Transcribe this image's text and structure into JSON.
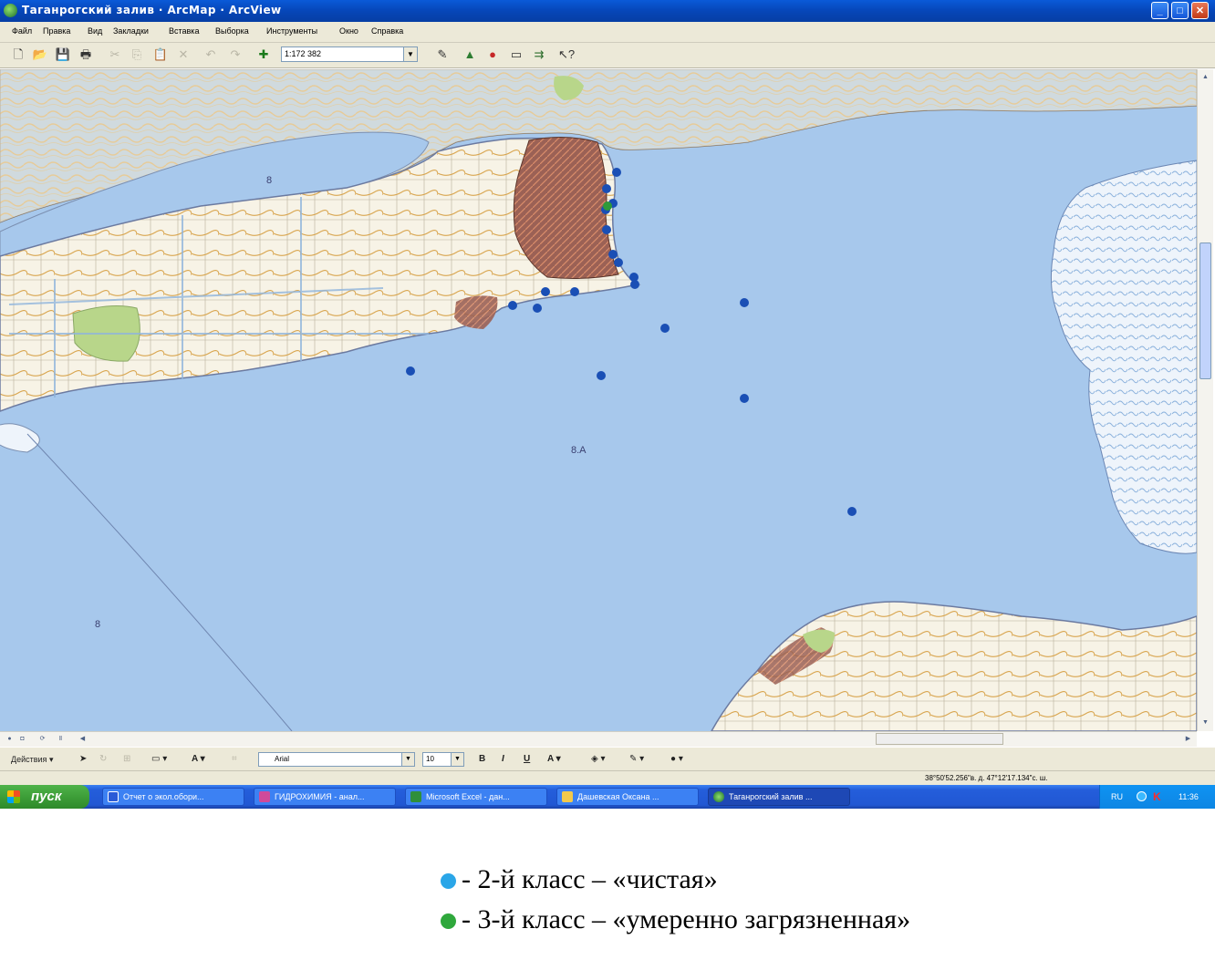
{
  "window": {
    "title": "Таганрогский залив · ArcMap · ArcView",
    "minimize_label": "_",
    "maximize_label": "□",
    "close_label": "✕"
  },
  "menu": {
    "items": [
      "Файл",
      "Правка",
      "Вид",
      "Закладки",
      "Вставка",
      "Выборка",
      "Инструменты",
      "Окно",
      "Справка"
    ]
  },
  "toolbar": {
    "scale": "1:172 382"
  },
  "map": {
    "labels": [
      "8",
      "8.A",
      "8"
    ],
    "water_color": "#a7c8ec",
    "land_color": "#f6f0e0",
    "contour_color": "#d9a650",
    "urban_color": "#9b6155",
    "station_class2_color": "#1a4fb5",
    "station_class3_color": "#2e9a3a"
  },
  "drawbar": {
    "actions_label": "Действия",
    "font": "Arial",
    "font_size": "10",
    "bold": "B",
    "italic": "I",
    "underline": "U"
  },
  "status": {
    "coordinates": "38°50'52.256\"в. д.   47°12'17.134\"с. ш."
  },
  "taskbar": {
    "start_label": "пуск",
    "tasks": [
      "Отчет о экол.обори...",
      "ГИДРОХИМИЯ - анал...",
      "Microsoft Excel - дан...",
      "Дашевская Оксана ...",
      "Таганрогский залив ..."
    ],
    "tray_lang": "RU",
    "tray_k": "K",
    "clock": "11:36"
  },
  "legend": {
    "items": [
      {
        "label": "- 2-й класс – «чистая»",
        "color": "#2aa6e8"
      },
      {
        "label": "- 3-й класс – «умеренно загрязненная»",
        "color": "#2fa83c"
      }
    ]
  }
}
